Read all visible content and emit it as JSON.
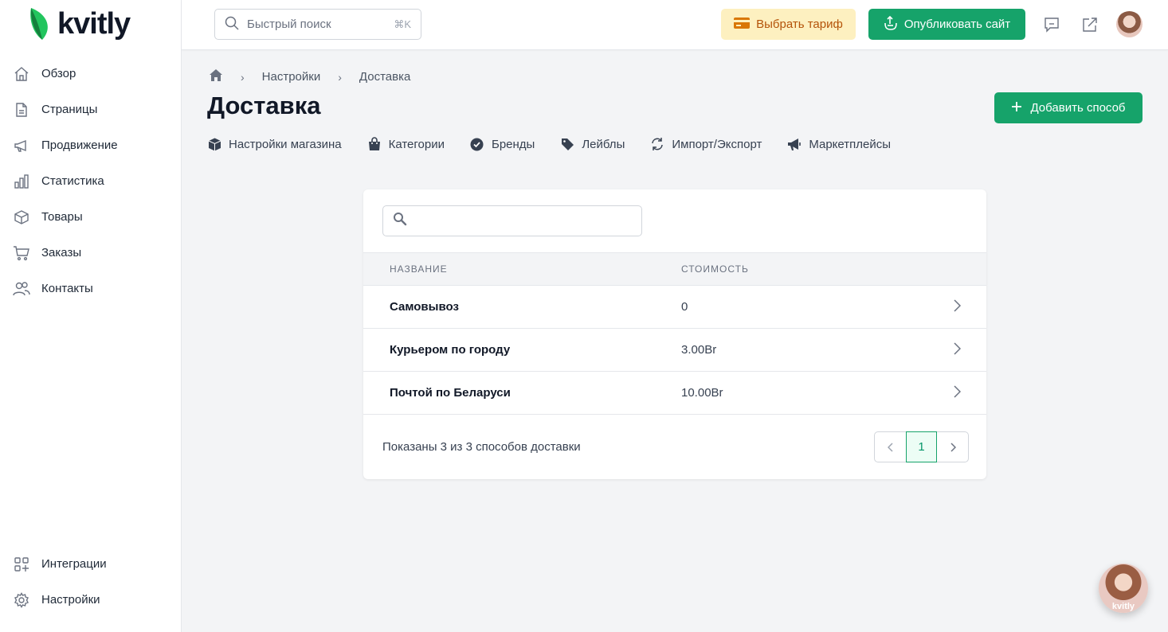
{
  "app": {
    "logo_text": "kvitly"
  },
  "sidebar": {
    "items": [
      {
        "label": "Обзор",
        "icon": "home-icon"
      },
      {
        "label": "Страницы",
        "icon": "page-icon"
      },
      {
        "label": "Продвижение",
        "icon": "megaphone-icon"
      },
      {
        "label": "Статистика",
        "icon": "chart-icon"
      },
      {
        "label": "Товары",
        "icon": "box-icon"
      },
      {
        "label": "Заказы",
        "icon": "cart-icon"
      },
      {
        "label": "Контакты",
        "icon": "users-icon"
      }
    ],
    "bottom_items": [
      {
        "label": "Интеграции",
        "icon": "integrations-icon"
      },
      {
        "label": "Настройки",
        "icon": "gear-icon"
      }
    ]
  },
  "topbar": {
    "search_placeholder": "Быстрый поиск",
    "search_shortcut": "⌘K",
    "tariff_label": "Выбрать тариф",
    "publish_label": "Опубликовать сайт"
  },
  "breadcrumb": {
    "items": [
      "Настройки",
      "Доставка"
    ]
  },
  "page": {
    "title": "Доставка",
    "add_label": "Добавить способ"
  },
  "tabs": [
    {
      "label": "Настройки магазина",
      "icon": "cube-icon"
    },
    {
      "label": "Категории",
      "icon": "bag-icon"
    },
    {
      "label": "Бренды",
      "icon": "badge-check-icon"
    },
    {
      "label": "Лейблы",
      "icon": "tag-icon"
    },
    {
      "label": "Импорт/Экспорт",
      "icon": "sync-icon"
    },
    {
      "label": "Маркетплейсы",
      "icon": "bullhorn-icon"
    }
  ],
  "table": {
    "search_value": "",
    "columns": [
      "НАЗВАНИЕ",
      "СТОИМОСТЬ"
    ],
    "rows": [
      {
        "name": "Самовывоз",
        "cost": "0"
      },
      {
        "name": "Курьером по городу",
        "cost": "3.00Br"
      },
      {
        "name": "Почтой по Беларуси",
        "cost": "10.00Br"
      }
    ],
    "footer": "Показаны 3 из 3 способов доставки",
    "current_page": "1"
  },
  "chat": {
    "label": "kvitly"
  },
  "colors": {
    "accent": "#16a36a",
    "tariff_bg": "#fdf0c0",
    "tariff_text": "#b45309"
  }
}
